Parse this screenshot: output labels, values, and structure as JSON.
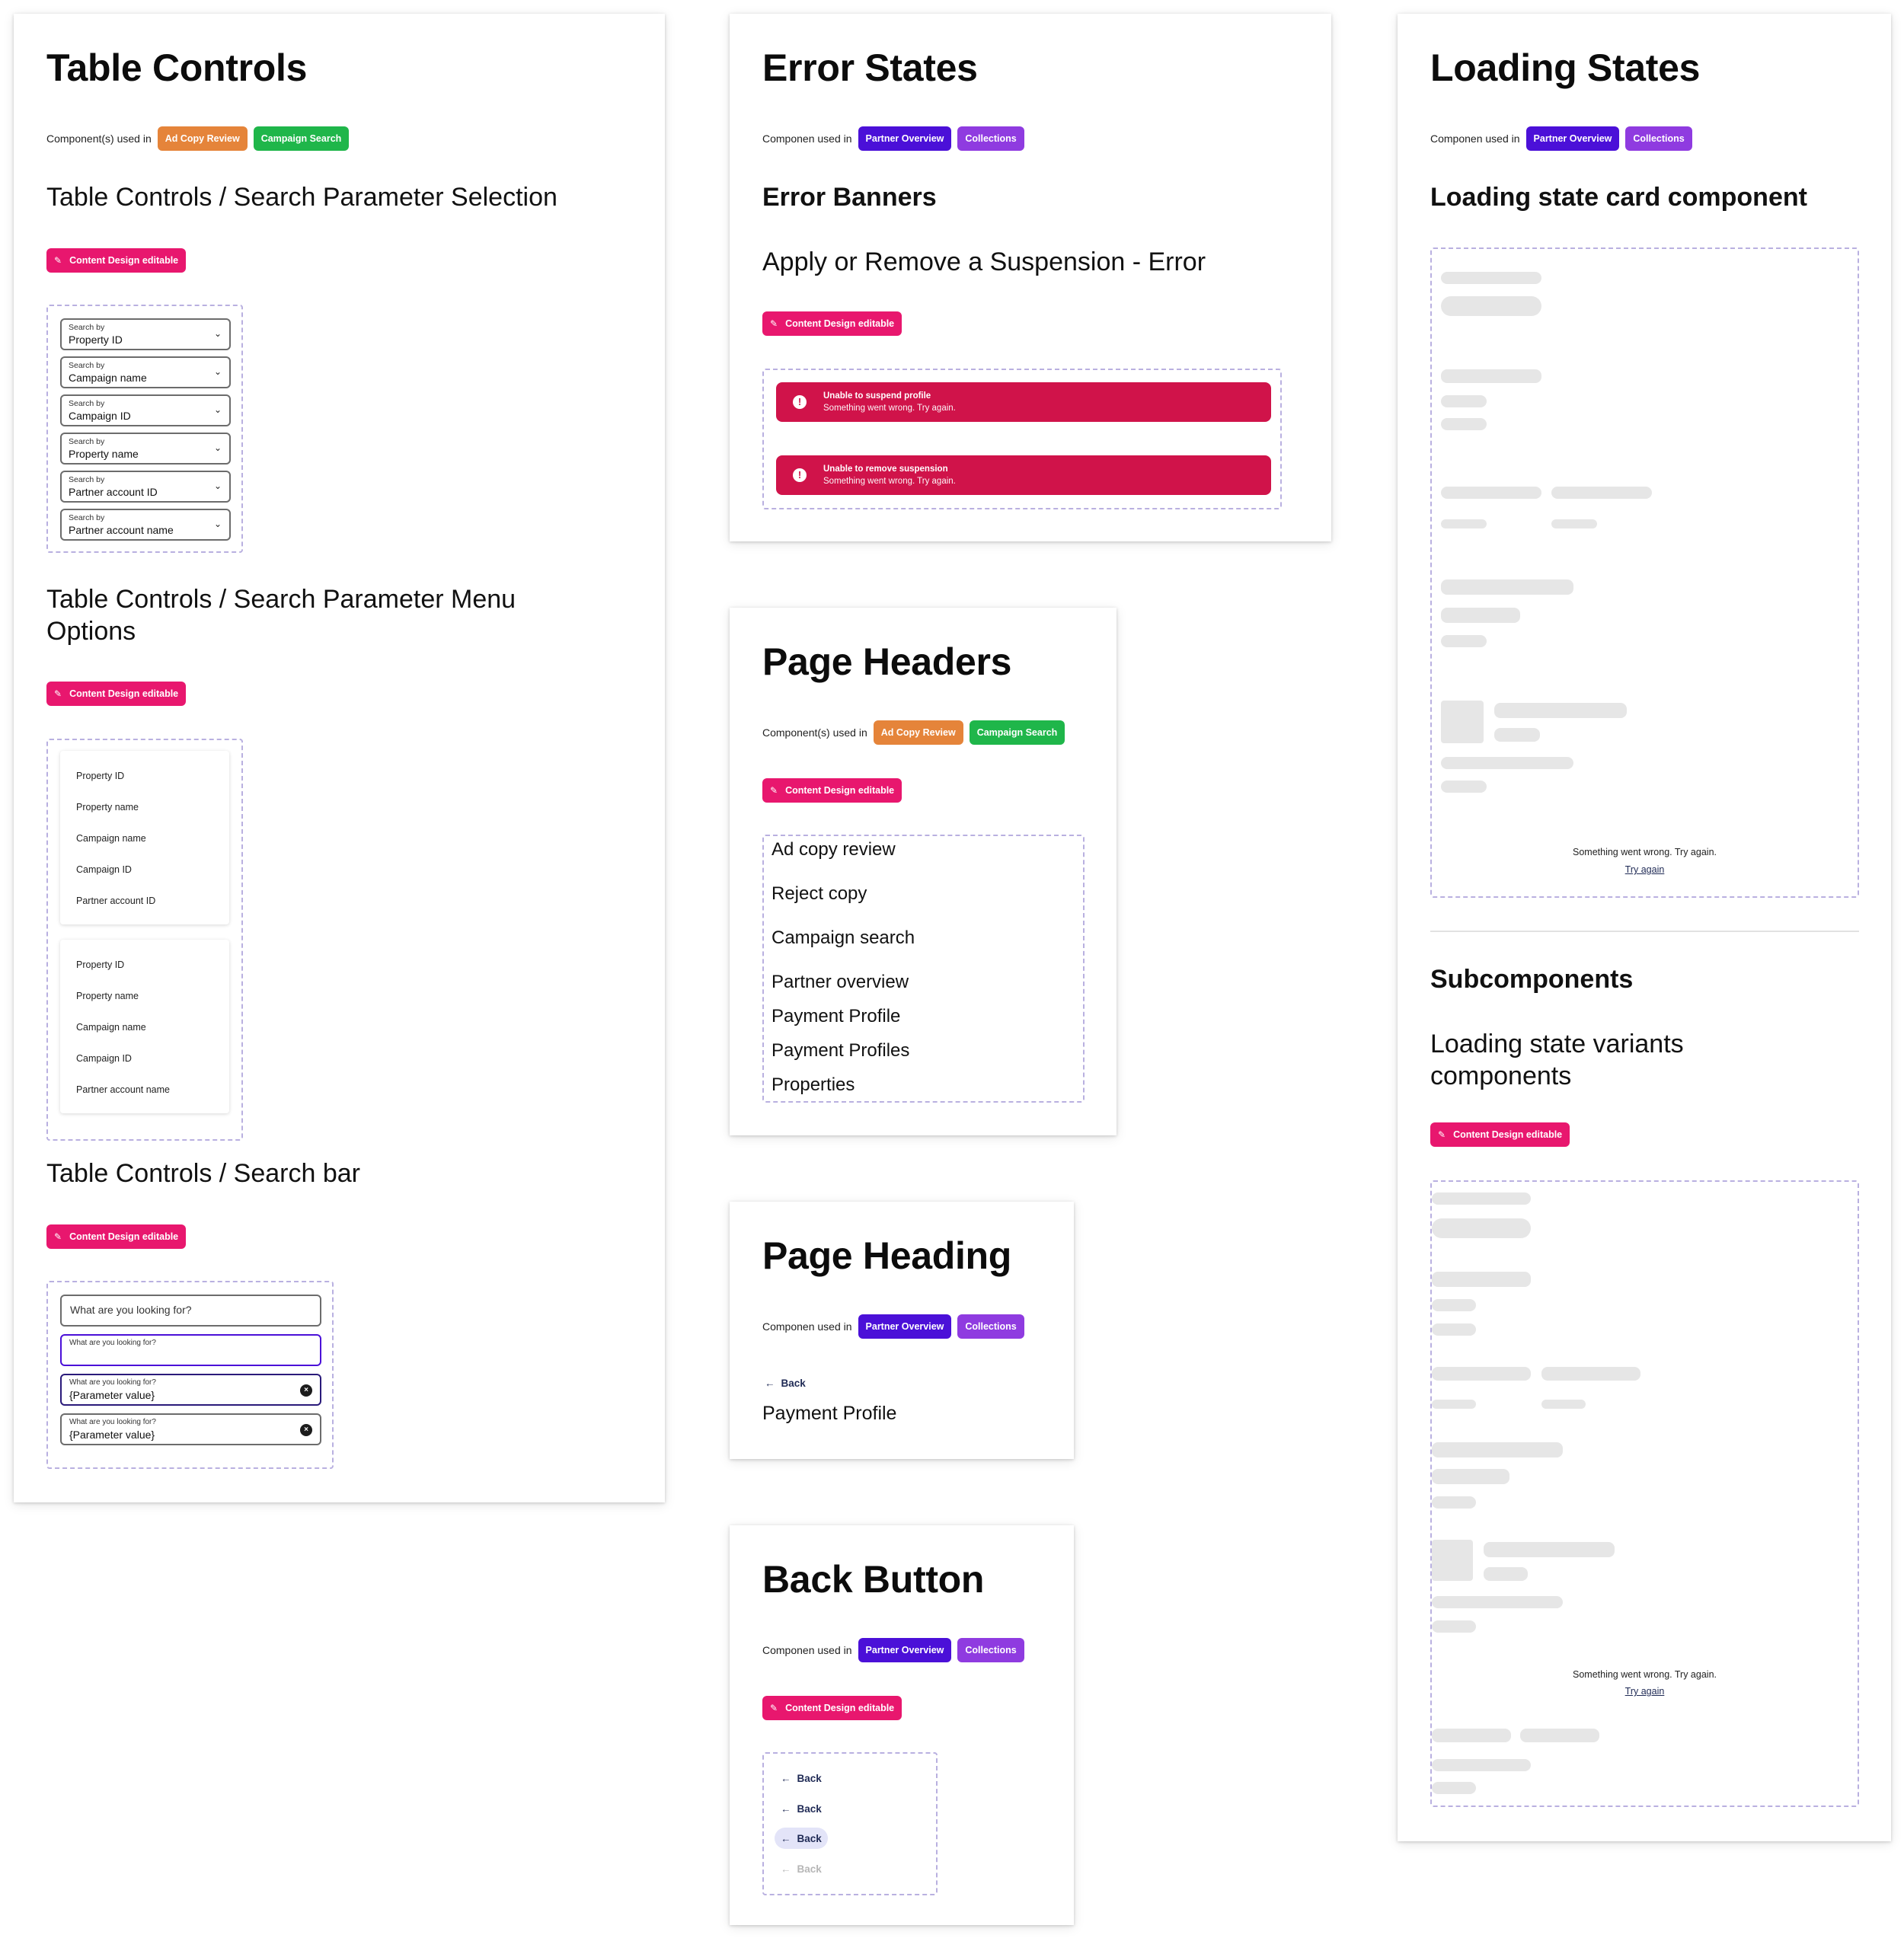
{
  "colors": {
    "orange": "#e5843a",
    "green": "#1fb64a",
    "indigo": "#4b10d8",
    "purple": "#8f3be0",
    "pink": "#e8176e",
    "error": "#d0134a"
  },
  "common": {
    "content_design_editable": "Content Design editable",
    "pencil_icon": "pencil-icon",
    "chevron_icon": "chevron-down-icon",
    "back_arrow": "←",
    "pencil_glyph": "✎",
    "chevron_glyph": "⌄",
    "clear_glyph": "×",
    "alert_glyph": "!"
  },
  "table_controls": {
    "title": "Table Controls",
    "used_in_label": "Component(s) used in",
    "tags": [
      "Ad Copy Review",
      "Campaign Search"
    ],
    "section1_title": "Table Controls / Search Parameter Selection",
    "selects": [
      {
        "label": "Search by",
        "value": "Property ID"
      },
      {
        "label": "Search by",
        "value": "Campaign name"
      },
      {
        "label": "Search by",
        "value": "Campaign ID"
      },
      {
        "label": "Search by",
        "value": "Property name"
      },
      {
        "label": "Search by",
        "value": "Partner account ID"
      },
      {
        "label": "Search by",
        "value": "Partner account name"
      }
    ],
    "section2_title": "Table Controls / Search Parameter Menu Options",
    "menu1": [
      "Property ID",
      "Property name",
      "Campaign name",
      "Campaign ID",
      "Partner account ID"
    ],
    "menu2": [
      "Property ID",
      "Property name",
      "Campaign name",
      "Campaign ID",
      "Partner account name"
    ],
    "section3_title": "Table Controls / Search bar",
    "search": {
      "placeholder": "What are you looking for?",
      "label": "What are you looking for?",
      "value": "{Parameter value}"
    }
  },
  "error_states": {
    "title": "Error States",
    "used_in_label": "Componen used in",
    "tags": [
      "Partner Overview",
      "Collections"
    ],
    "subtitle": "Error Banners",
    "section_title": "Apply or Remove a Suspension - Error",
    "banners": [
      {
        "title": "Unable to suspend profile",
        "message": "Something went wrong. Try again."
      },
      {
        "title": "Unable to remove suspension",
        "message": "Something went wrong. Try again."
      }
    ]
  },
  "page_headers": {
    "title": "Page Headers",
    "used_in_label": "Component(s) used in",
    "tags": [
      "Ad Copy Review",
      "Campaign Search"
    ],
    "items": [
      "Ad copy review",
      "Reject copy",
      "Campaign search",
      "Partner overview",
      "Payment Profile",
      "Payment Profiles",
      "Properties"
    ]
  },
  "page_heading": {
    "title": "Page Heading",
    "used_in_label": "Componen used in",
    "tags": [
      "Partner Overview",
      "Collections"
    ],
    "back": "Back",
    "heading": "Payment Profile"
  },
  "back_button": {
    "title": "Back Button",
    "used_in_label": "Componen used in",
    "tags": [
      "Partner Overview",
      "Collections"
    ],
    "variants": [
      "Back",
      "Back",
      "Back",
      "Back"
    ]
  },
  "loading_states": {
    "title": "Loading States",
    "used_in_label": "Componen used in",
    "tags": [
      "Partner Overview",
      "Collections"
    ],
    "subtitle": "Loading state card component",
    "error_message": "Something went wrong. Try again.",
    "retry": "Try again",
    "sub_title": "Subcomponents",
    "sub_section_title": "Loading state variants components"
  }
}
